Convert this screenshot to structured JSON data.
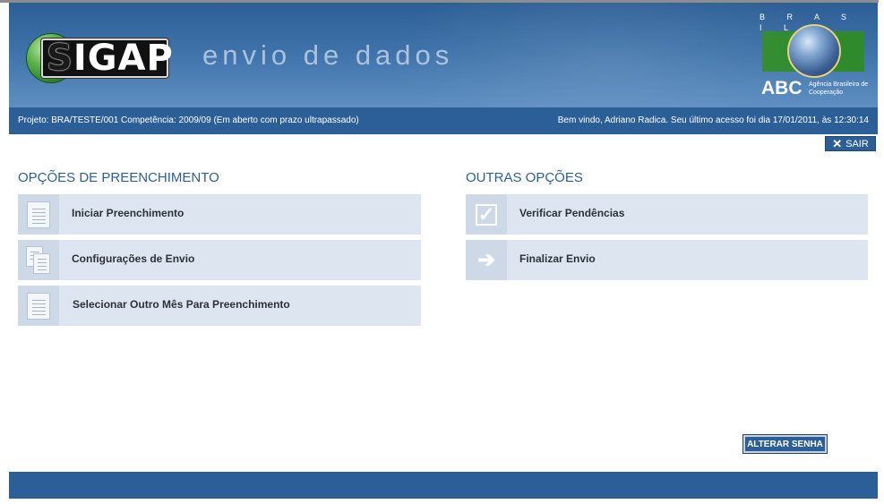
{
  "header": {
    "logo_text": "SIGAP",
    "logo_first_letter": "S",
    "logo_rest": "IGAP",
    "tagline": "envio de dados",
    "brasil_label": "B R A S I L",
    "abc_label": "ABC",
    "abc_subtitle": "Agência Brasileira de Cooperação"
  },
  "infobar": {
    "project_text": "Projeto: BRA/TESTE/001 Competência: 2009/09 (Em aberto com prazo ultrapassado)",
    "welcome_text": "Bem vindo, Adriano Radica. Seu último acesso foi dia 17/01/2011, às 12:30:14"
  },
  "sair": {
    "icon": "close-icon",
    "label": "SAIR"
  },
  "sections": {
    "fill": {
      "title": "OPÇÕES DE PREENCHIMENTO",
      "items": [
        {
          "label": "Iniciar Preenchimento",
          "icon": "document-icon"
        },
        {
          "label": "Configurações de Envio",
          "icon": "documents-icon"
        },
        {
          "label": "Selecionar Outro Mês Para Preenchimento",
          "icon": "document-icon"
        }
      ]
    },
    "other": {
      "title": "OUTRAS OPÇÕES",
      "items": [
        {
          "label": "Verificar Pendências",
          "icon": "checkbox-icon"
        },
        {
          "label": "Finalizar Envio",
          "icon": "arrow-right-icon"
        }
      ]
    }
  },
  "buttons": {
    "change_password": "ALTERAR SENHA"
  },
  "colors": {
    "primary": "#2c5f97",
    "option_bg": "#dde6f0",
    "option_icon_bg": "#cdd9e6",
    "logo_green": "#5fb64f"
  }
}
